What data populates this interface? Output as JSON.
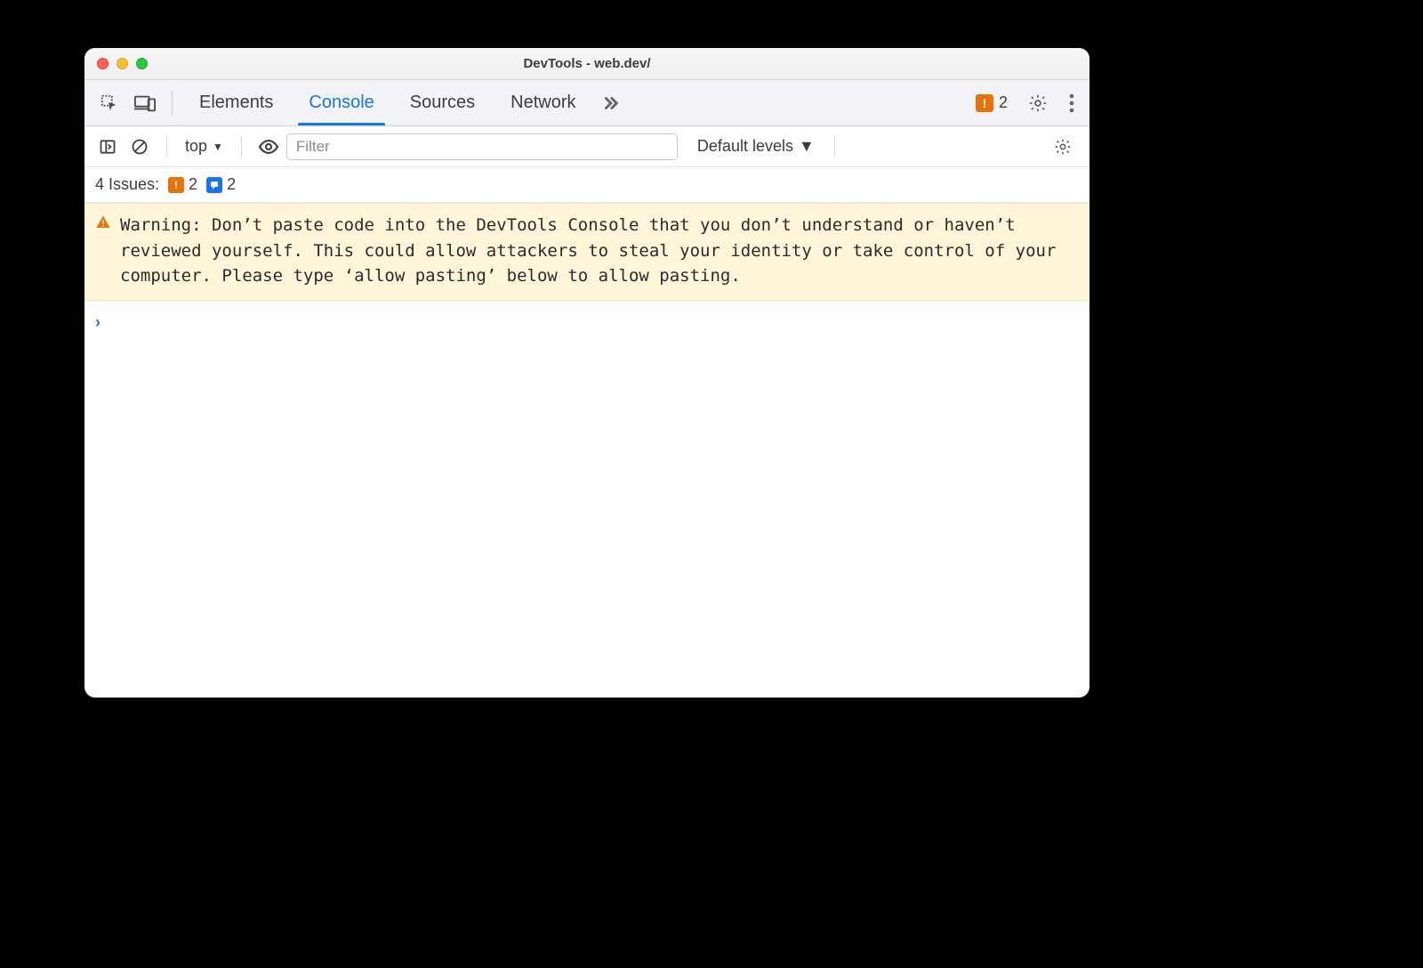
{
  "window": {
    "title": "DevTools - web.dev/"
  },
  "tabs": {
    "items": [
      "Elements",
      "Console",
      "Sources",
      "Network"
    ],
    "active_index": 1
  },
  "tabbar_issue_count": "2",
  "toolbar": {
    "context_label": "top",
    "filter_placeholder": "Filter",
    "levels_label": "Default levels"
  },
  "issues": {
    "label": "4 Issues:",
    "orange_count": "2",
    "blue_count": "2"
  },
  "warning": {
    "text": "Warning: Don’t paste code into the DevTools Console that you don’t understand or haven’t reviewed yourself. This could allow attackers to steal your identity or take control of your computer. Please type ‘allow pasting’ below to allow pasting."
  }
}
